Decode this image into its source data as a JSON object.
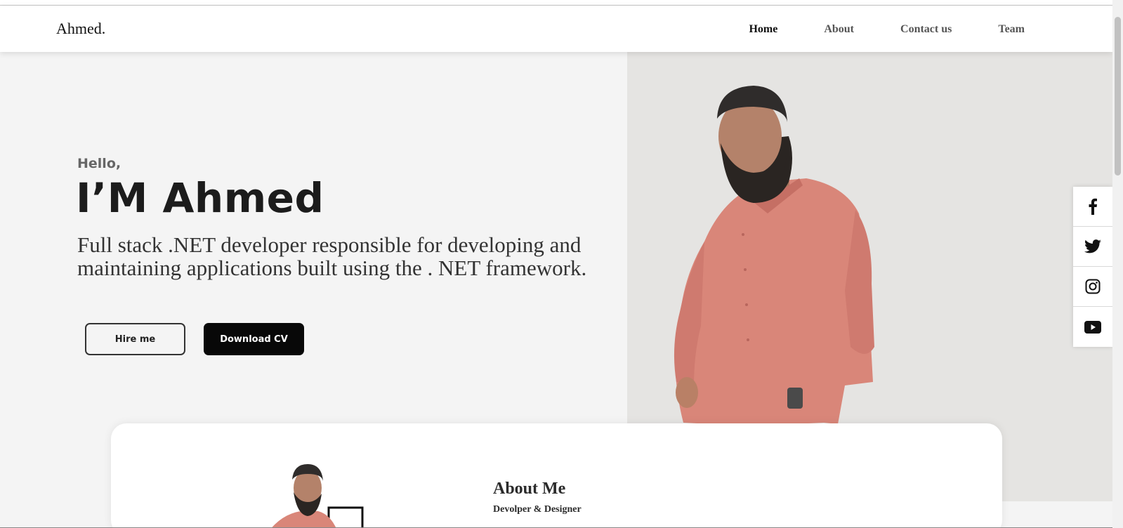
{
  "brand": "Ahmed.",
  "nav": {
    "home": "Home",
    "about": "About",
    "contact": "Contact us",
    "team": "Team"
  },
  "hero": {
    "greeting": "Hello,",
    "name": "I’M Ahmed",
    "description": "Full stack .NET developer responsible for developing and maintaining applications built using the . NET framework.",
    "hire_label": "Hire me",
    "cv_label": "Download CV"
  },
  "social": [
    "facebook-icon",
    "twitter-icon",
    "instagram-icon",
    "youtube-icon"
  ],
  "about": {
    "title": "About Me",
    "subtitle": "Devolper & Designer"
  },
  "colors": {
    "accent": "#080808",
    "shirt": "#d98679",
    "hero_right_bg": "#e5e4e2"
  }
}
